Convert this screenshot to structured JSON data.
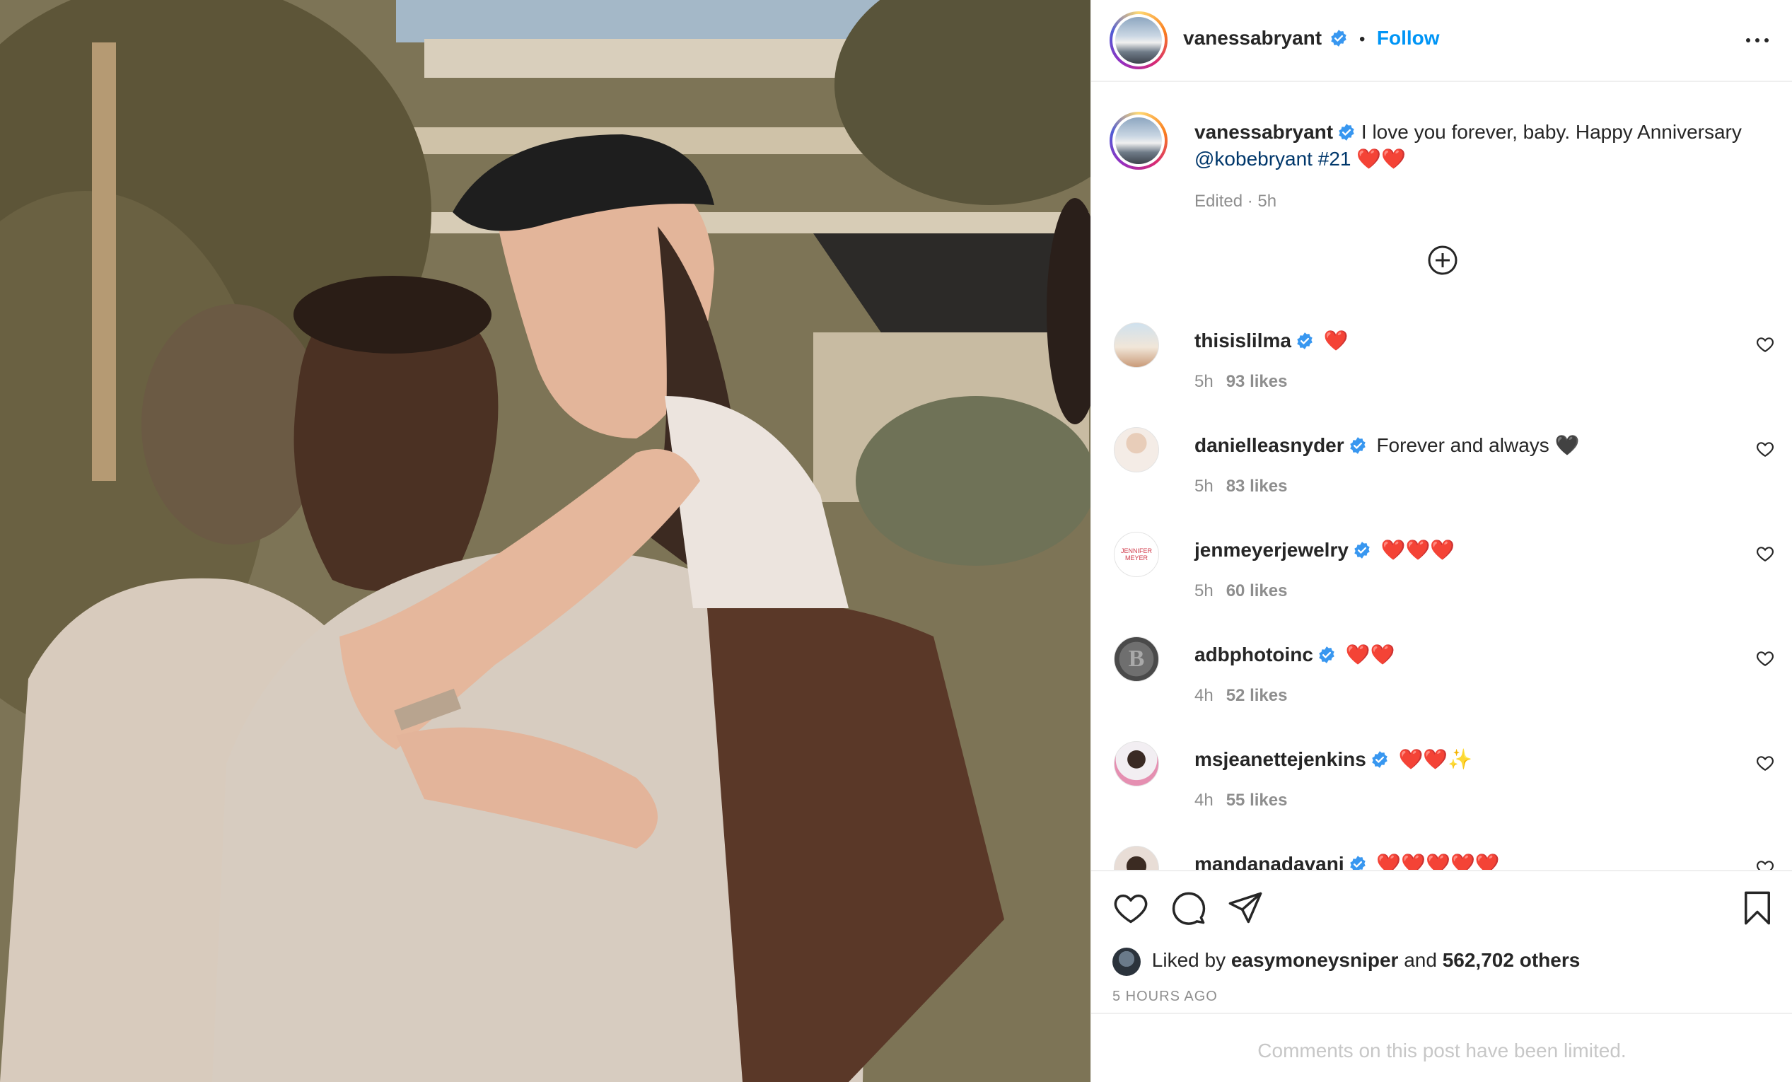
{
  "post": {
    "author": "vanessabryant",
    "follow_label": "Follow",
    "separator": "•",
    "caption_text": "I love you forever, baby. Happy Anniversary",
    "caption_mention": "@kobebryant",
    "caption_hashtag": "#21",
    "caption_emoji": "❤️❤️",
    "edited": "Edited · 5h"
  },
  "comments": [
    {
      "user": "thisislilma",
      "text": "❤️",
      "time": "5h",
      "likes": "93 likes"
    },
    {
      "user": "danielleasnyder",
      "text": "Forever and always 🖤",
      "time": "5h",
      "likes": "83 likes"
    },
    {
      "user": "jenmeyerjewelry",
      "text": "❤️❤️❤️",
      "time": "5h",
      "likes": "60 likes",
      "logo_text": "JENNIFER MEYER"
    },
    {
      "user": "adbphotoinc",
      "text": "❤️❤️",
      "time": "4h",
      "likes": "52 likes",
      "logo_text": "B"
    },
    {
      "user": "msjeanettejenkins",
      "text": "❤️❤️✨",
      "time": "4h",
      "likes": "55 likes"
    },
    {
      "user": "mandanadavani",
      "text": "❤️❤️❤️❤️❤️",
      "time": "",
      "likes": ""
    }
  ],
  "likes": {
    "prefix": "Liked by",
    "user": "easymoneysniper",
    "middle": "and",
    "count": "562,702 others"
  },
  "time_ago": "5 HOURS AGO",
  "comments_limited": "Comments on this post have been limited.",
  "colors": {
    "accent_blue": "#0095f6",
    "mention_blue": "#00376b",
    "muted_gray": "#8e8e8e",
    "text_dark": "#262626",
    "verified_blue": "#3897f0"
  },
  "icons": [
    "more-options-icon",
    "verified-badge-icon",
    "load-more-comments-icon",
    "like-heart-icon",
    "comment-icon",
    "share-icon",
    "save-bookmark-icon"
  ]
}
